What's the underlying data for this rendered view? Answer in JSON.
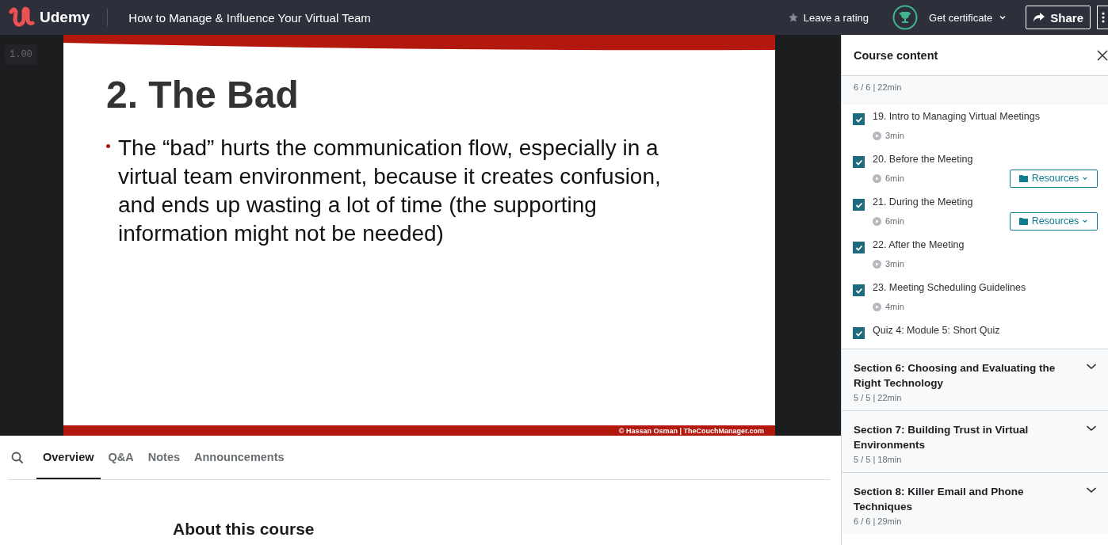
{
  "header": {
    "logo": "Udemy",
    "course_title": "How to Manage & Influence Your Virtual Team",
    "rating_link": "Leave a rating",
    "certificate": "Get certificate",
    "share": "Share"
  },
  "player": {
    "speed": "1.00",
    "slide": {
      "title": "2. The Bad",
      "bullets": [
        "The “bad” hurts the communication flow, especially in a virtual team environment, because it creates confusion, and ends up wasting a lot of time (the supporting information might not be needed)"
      ],
      "footer": "© Hassan Osman | TheCouchManager.com"
    }
  },
  "tabs": [
    {
      "label": "Overview",
      "selected": true
    },
    {
      "label": "Q&A",
      "selected": false
    },
    {
      "label": "Notes",
      "selected": false
    },
    {
      "label": "Announcements",
      "selected": false
    }
  ],
  "overview": {
    "heading": "About this course"
  },
  "sidebar": {
    "title": "Course content",
    "current_section_meta": "6 / 6 | 22min",
    "lessons": [
      {
        "title": "19. Intro to Managing Virtual Meetings",
        "duration": "3min",
        "checked": true,
        "kind": "video"
      },
      {
        "title": "20. Before the Meeting",
        "duration": "6min",
        "checked": true,
        "kind": "video",
        "resources": "Resources"
      },
      {
        "title": "21. During the Meeting",
        "duration": "6min",
        "checked": true,
        "kind": "video",
        "resources": "Resources"
      },
      {
        "title": "22. After the Meeting",
        "duration": "3min",
        "checked": true,
        "kind": "video"
      },
      {
        "title": "23. Meeting Scheduling Guidelines",
        "duration": "4min",
        "checked": true,
        "kind": "video"
      },
      {
        "title": "Quiz 4: Module 5: Short Quiz",
        "checked": true,
        "kind": "quiz"
      }
    ],
    "sections": [
      {
        "title": "Section 6: Choosing and Evaluating the Right Technology",
        "meta": "5 / 5 | 22min",
        "expanded": false
      },
      {
        "title": "Section 7: Building Trust in Virtual Environments",
        "meta": "5 / 5 | 18min",
        "expanded": false
      },
      {
        "title": "Section 8: Killer Email and Phone Techniques",
        "meta": "6 / 6 | 29min",
        "expanded": false
      }
    ]
  }
}
